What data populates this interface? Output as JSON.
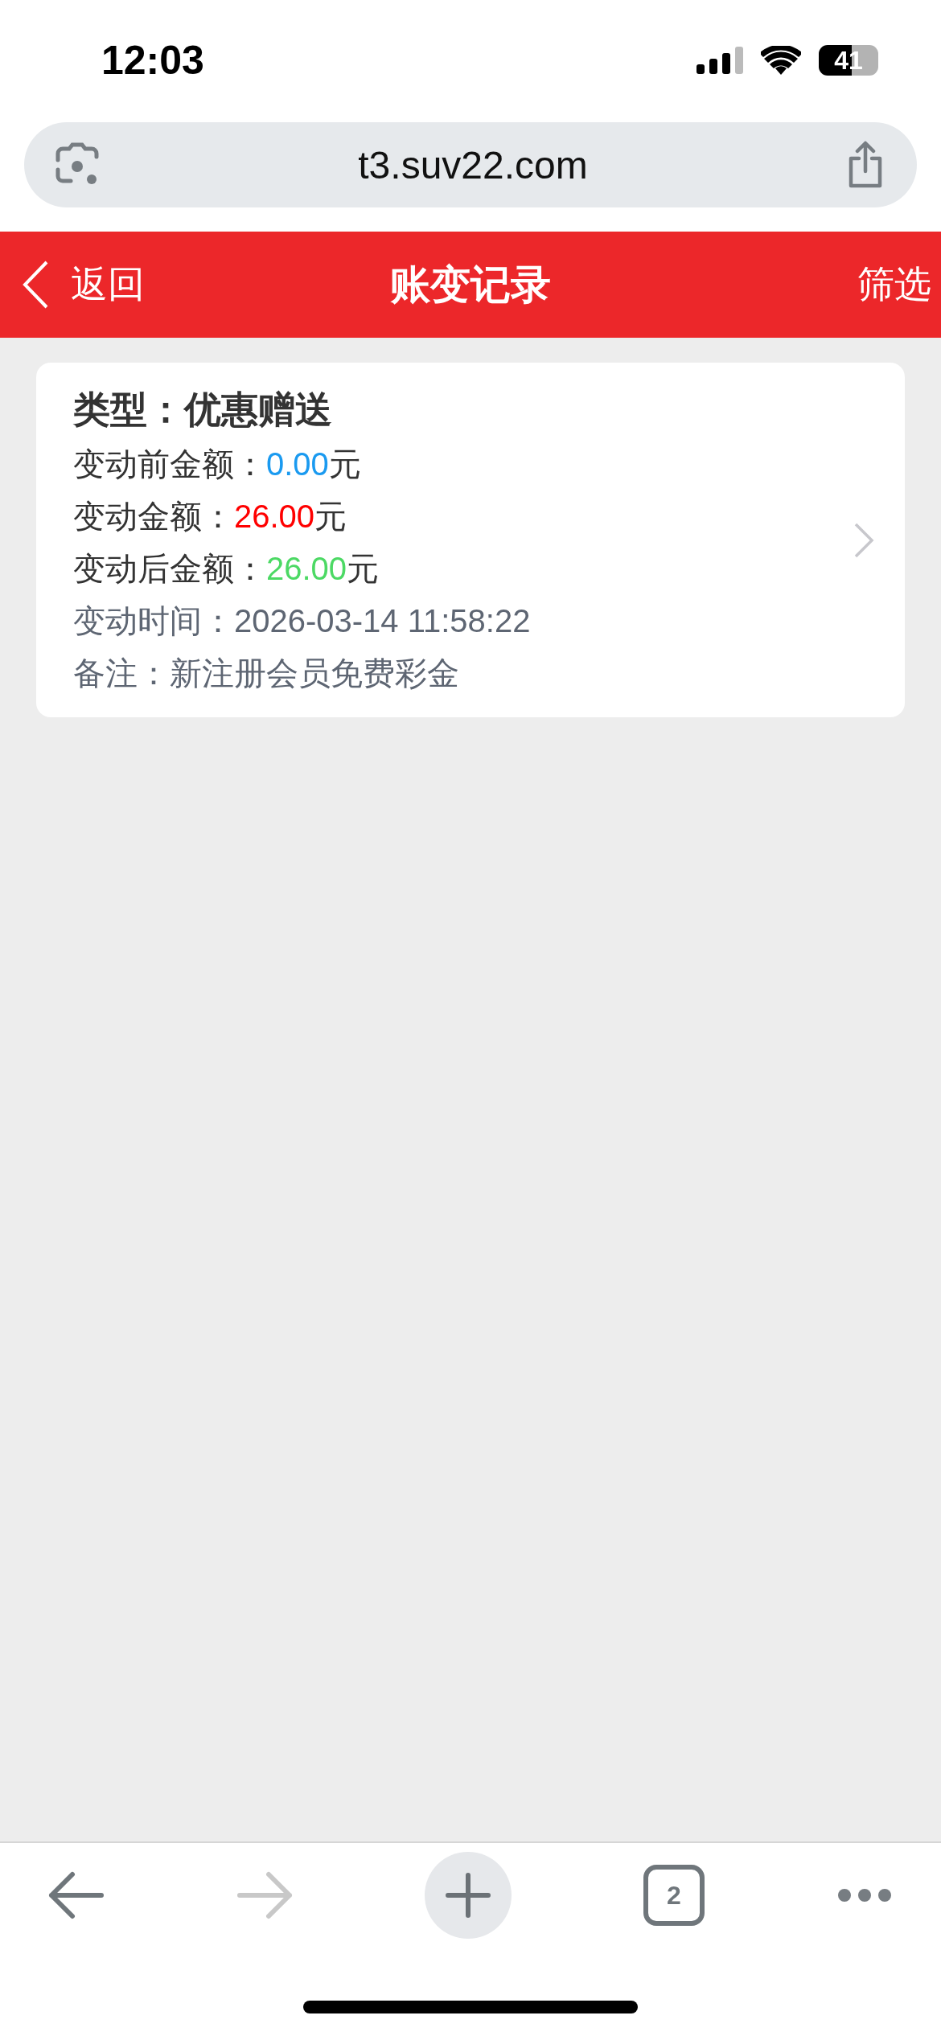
{
  "status_bar": {
    "time": "12:03",
    "battery": "41"
  },
  "browser": {
    "url": "t3.suv22.com",
    "tab_count": "2"
  },
  "header": {
    "back_label": "返回",
    "title": "账变记录",
    "filter_label": "筛选"
  },
  "records": [
    {
      "type_label": "类型：",
      "type_value": "优惠赠送",
      "fields": [
        {
          "kind": "amount",
          "label": "变动前金额：",
          "value": "0.00",
          "unit": "元",
          "color": "#1a9af0"
        },
        {
          "kind": "amount",
          "label": "变动金额：",
          "value": "26.00",
          "unit": "元",
          "color": "#ff0000"
        },
        {
          "kind": "amount",
          "label": "变动后金额：",
          "value": "26.00",
          "unit": "元",
          "color": "#4cd964"
        },
        {
          "kind": "text",
          "label": "变动时间：",
          "value": "2026-03-14 11:58:22"
        },
        {
          "kind": "text",
          "label": "备注：",
          "value": "新注册会员免费彩金"
        }
      ]
    }
  ],
  "toolbar": {
    "back_disabled": false,
    "forward_disabled": true
  }
}
